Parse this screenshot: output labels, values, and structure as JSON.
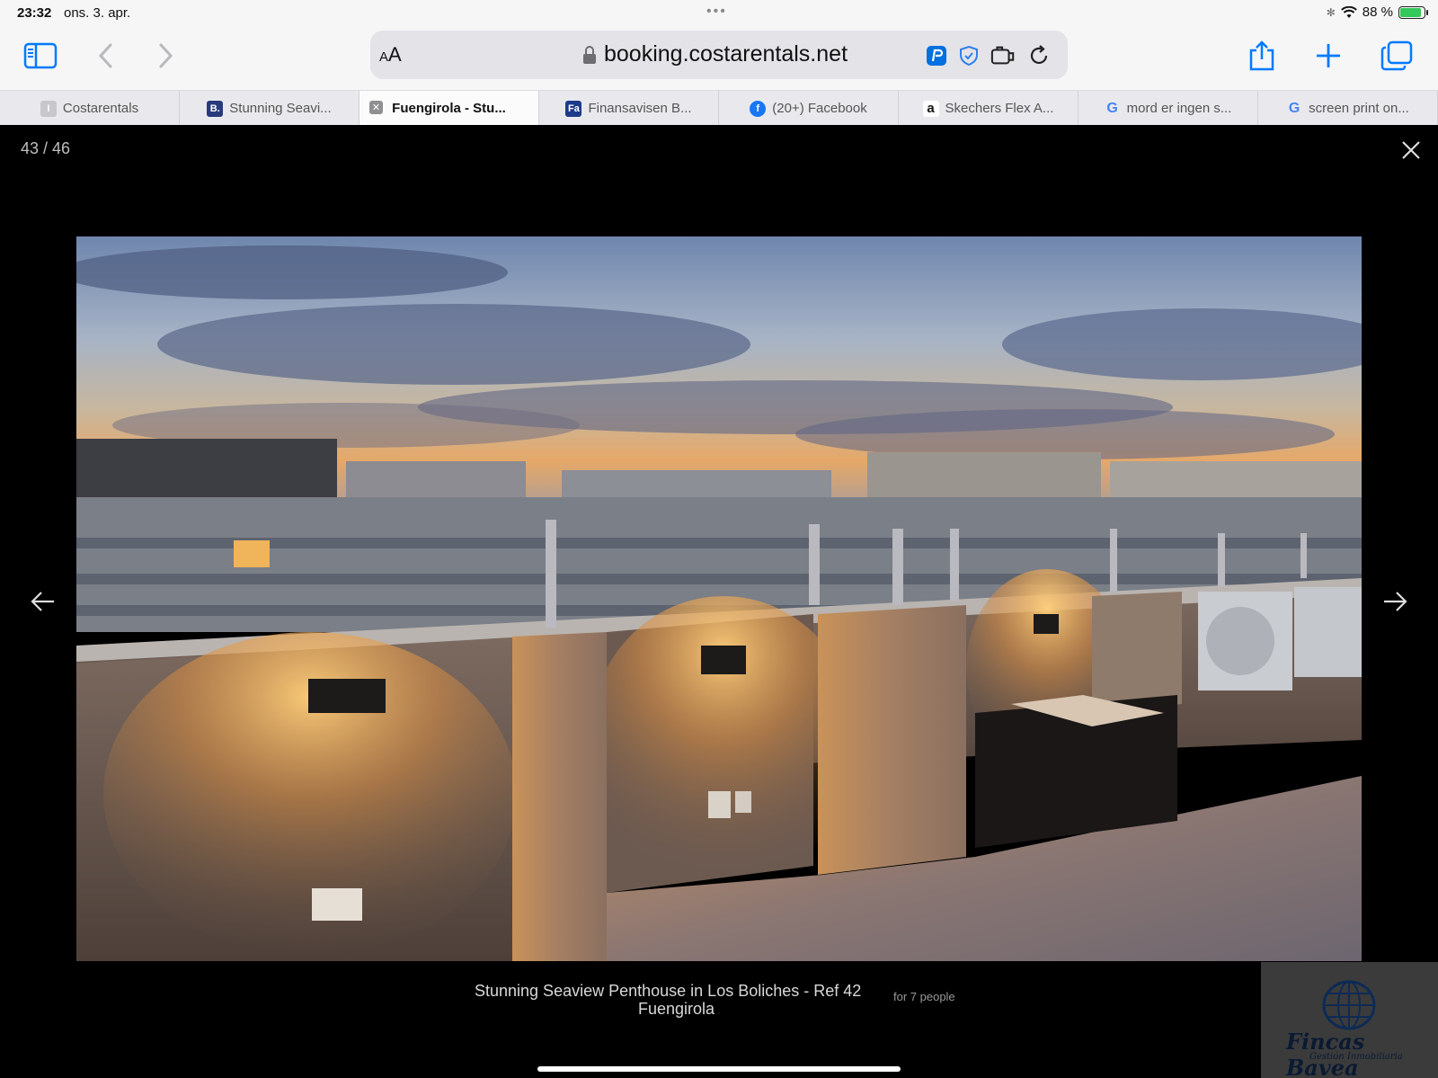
{
  "status": {
    "time": "23:32",
    "date": "ons. 3. apr.",
    "battery": "88 %",
    "battery_level": 0.88
  },
  "toolbar": {
    "text_size_label_small": "A",
    "text_size_label_large": "A",
    "url_host": "booking.costarentals.net"
  },
  "tabs": [
    {
      "title": "Costarentals",
      "fav": "I",
      "fav_color": "#c7c7cc"
    },
    {
      "title": "Stunning Seavi...",
      "fav": "B.",
      "fav_color": "#273b7d"
    },
    {
      "title": "Fuengirola - Stu...",
      "active": true
    },
    {
      "title": "Finansavisen B...",
      "fav": "Fa",
      "fav_color": "#1d3a8a"
    },
    {
      "title": "(20+) Facebook",
      "fav_color": "#1877f2"
    },
    {
      "title": "Skechers Flex A...",
      "fav": "a",
      "fav_color": "#ffffff"
    },
    {
      "title": "mord er ingen s...",
      "fav": "G"
    },
    {
      "title": "screen print on...",
      "fav": "G"
    }
  ],
  "lightbox": {
    "counter": "43 / 46",
    "caption_line1": "Stunning Seaview Penthouse in Los Boliches - Ref 42",
    "caption_line2": "Fuengirola",
    "people": "for 7 people",
    "logo_name": "Fincas Bavea",
    "logo_sub": "Gestión Inmobiliaria"
  },
  "colors": {
    "accent": "#007aff",
    "background": "#000000"
  }
}
